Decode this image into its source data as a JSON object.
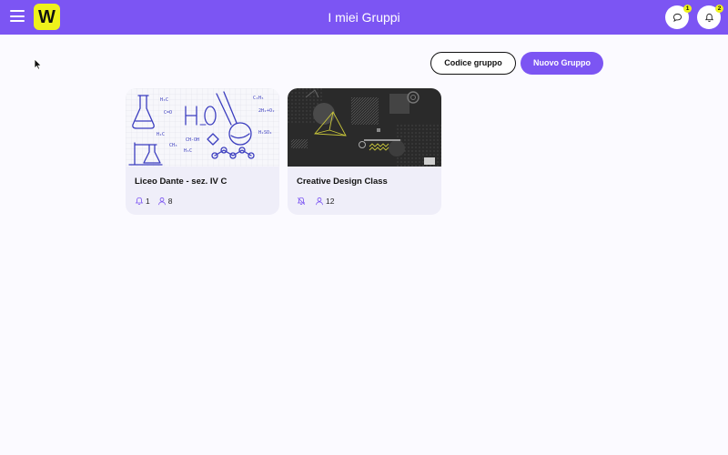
{
  "header": {
    "title": "I miei Gruppi",
    "logo_letter": "W",
    "messages_badge": "1",
    "notifications_badge": "2"
  },
  "actions": {
    "group_code_label": "Codice gruppo",
    "new_group_label": "Nuovo Gruppo"
  },
  "groups": [
    {
      "name": "Liceo Dante - sez. IV C",
      "notifications": "1",
      "members": "8",
      "notifications_muted": false
    },
    {
      "name": "Creative Design Class",
      "notifications": "",
      "members": "12",
      "notifications_muted": true
    }
  ],
  "colors": {
    "header": "#7c55f3",
    "accent_yellow": "#eef21b",
    "card_bg": "#efeef9",
    "sketch_ink": "#3b3dbf"
  },
  "icons": {
    "menu": "menu-icon",
    "logo": "logo-w-icon",
    "messages": "chat-bubble-icon",
    "notifications": "bell-icon",
    "notifications_off": "bell-off-icon",
    "members": "person-icon"
  }
}
